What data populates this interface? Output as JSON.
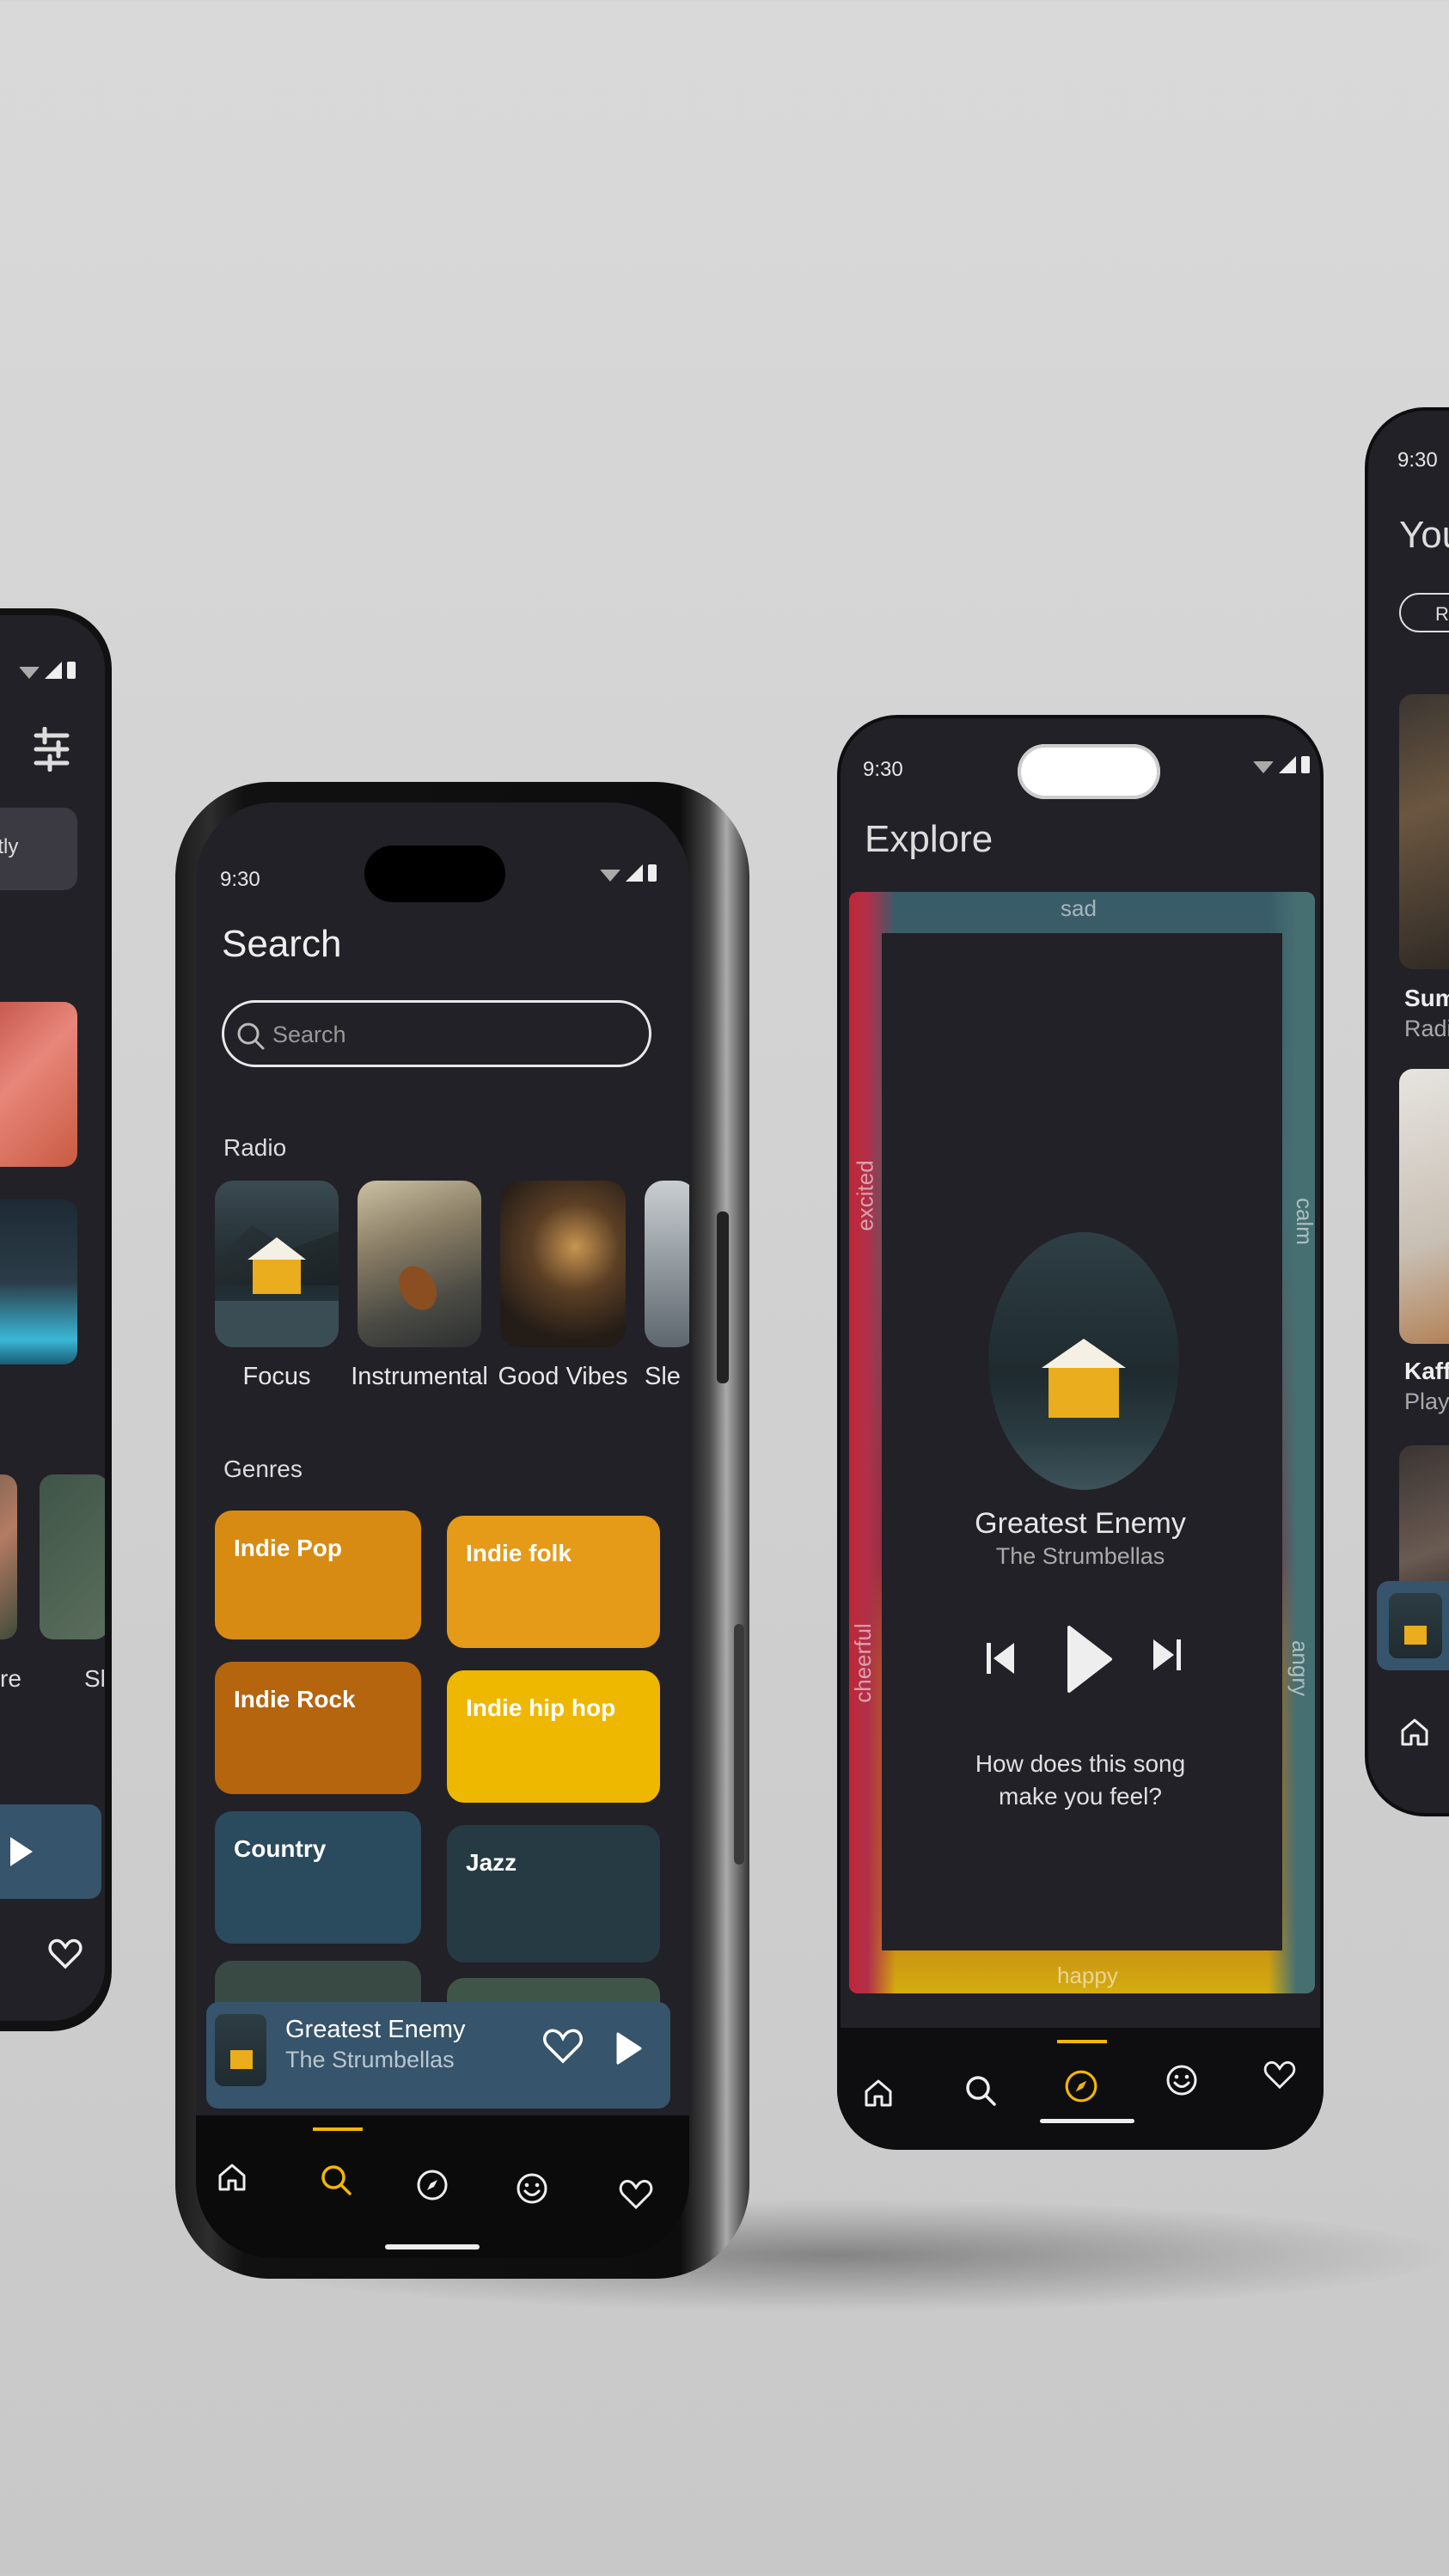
{
  "colors": {
    "accent": "#f2b705",
    "screen_bg": "#222127",
    "mini_player_bg": "#36546b",
    "genre_indie_pop": "#d88b12",
    "genre_indie_folk": "#e59a18",
    "genre_indie_rock": "#b4650e",
    "genre_indie_hiphop": "#efb800",
    "genre_country": "#2a4a5e",
    "genre_jazz": "#253a42"
  },
  "left_phone": {
    "chip": "ntly",
    "label_re": "re",
    "label_sl": "Slo"
  },
  "search_screen": {
    "time": "9:30",
    "title": "Search",
    "search_placeholder": "Search",
    "radio_heading": "Radio",
    "radio_items": [
      {
        "label": "Focus"
      },
      {
        "label": "Instrumental"
      },
      {
        "label": "Good Vibes"
      },
      {
        "label": "Sle"
      }
    ],
    "genres_heading": "Genres",
    "genres": [
      {
        "label": "Indie Pop"
      },
      {
        "label": "Indie folk"
      },
      {
        "label": "Indie Rock"
      },
      {
        "label": "Indie hip hop"
      },
      {
        "label": "Country"
      },
      {
        "label": "Jazz"
      }
    ],
    "mini_player": {
      "title": "Greatest Enemy",
      "artist": "The Strumbellas"
    },
    "nav": [
      "home-icon",
      "search-icon",
      "compass-icon",
      "smile-icon",
      "heart-icon"
    ],
    "active_nav": "search-icon"
  },
  "explore_screen": {
    "time": "9:30",
    "title": "Explore",
    "moods": {
      "top": "sad",
      "left_upper": "excited",
      "right_upper": "calm",
      "left_lower": "cheerful",
      "right_lower": "angry",
      "bottom": "happy"
    },
    "song_title": "Greatest Enemy",
    "artist": "The Strumbellas",
    "prompt": "How does this song make you feel?",
    "nav": [
      "home-icon",
      "search-icon",
      "compass-icon",
      "smile-icon",
      "heart-icon"
    ],
    "active_nav": "compass-icon"
  },
  "right_phone": {
    "time": "9:30",
    "title_partial": "You",
    "chip_partial": "Ra",
    "item1_title": "Sum",
    "item1_sub": "Radi",
    "item2_title": "Kaff",
    "item2_sub": "Play"
  }
}
